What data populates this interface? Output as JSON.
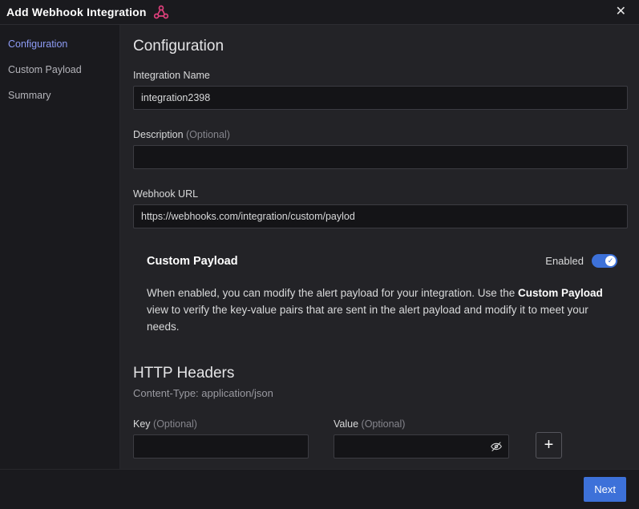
{
  "modal": {
    "title": "Add Webhook Integration",
    "close_glyph": "✕"
  },
  "sidebar": {
    "items": [
      {
        "label": "Configuration",
        "active": true
      },
      {
        "label": "Custom Payload",
        "active": false
      },
      {
        "label": "Summary",
        "active": false
      }
    ]
  },
  "main": {
    "heading": "Configuration",
    "fields": {
      "integration_name": {
        "label": "Integration Name",
        "value": "integration2398"
      },
      "description": {
        "label": "Description",
        "optional": "(Optional)",
        "value": ""
      },
      "webhook_url": {
        "label": "Webhook URL",
        "value": "https://webhooks.com/integration/custom/paylod"
      }
    },
    "custom_payload": {
      "title": "Custom Payload",
      "status": "Enabled",
      "toggle_check": "✓",
      "description_parts": [
        "When enabled, you can modify the alert payload for your integration. Use the ",
        "Custom Payload",
        " view to verify the key-value pairs that are sent in the alert payload and modify it to meet your needs."
      ]
    },
    "http_headers": {
      "title": "HTTP Headers",
      "subtitle": "Content-Type: application/json",
      "key_label": "Key",
      "key_optional": "(Optional)",
      "value_label": "Value",
      "value_optional": "(Optional)",
      "add_glyph": "+"
    }
  },
  "footer": {
    "next_label": "Next"
  },
  "colors": {
    "accent": "#3d71d9",
    "active_link": "#8e9cf5",
    "webhook_icon": "#e0407c"
  }
}
